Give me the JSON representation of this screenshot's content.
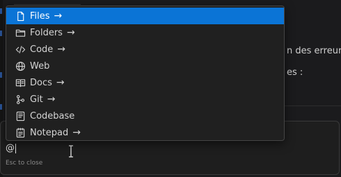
{
  "background": {
    "text_line_1": "n des erreurs",
    "text_line_2": "es :"
  },
  "menu": {
    "items": [
      {
        "label": "Files",
        "icon": "file-icon",
        "has_arrow": true,
        "selected": true
      },
      {
        "label": "Folders",
        "icon": "folder-icon",
        "has_arrow": true,
        "selected": false
      },
      {
        "label": "Code",
        "icon": "code-icon",
        "has_arrow": true,
        "selected": false
      },
      {
        "label": "Web",
        "icon": "globe-icon",
        "has_arrow": false,
        "selected": false
      },
      {
        "label": "Docs",
        "icon": "book-icon",
        "has_arrow": true,
        "selected": false
      },
      {
        "label": "Git",
        "icon": "git-branch-icon",
        "has_arrow": true,
        "selected": false
      },
      {
        "label": "Codebase",
        "icon": "codebase-icon",
        "has_arrow": false,
        "selected": false
      },
      {
        "label": "Notepad",
        "icon": "notepad-icon",
        "has_arrow": true,
        "selected": false
      }
    ],
    "arrow_glyph": "→"
  },
  "composer": {
    "input_value": "@",
    "hint": "Esc to close"
  },
  "colors": {
    "selected_bg": "#0b74d6",
    "menu_bg": "#202020",
    "page_bg": "#1b1b1d"
  }
}
